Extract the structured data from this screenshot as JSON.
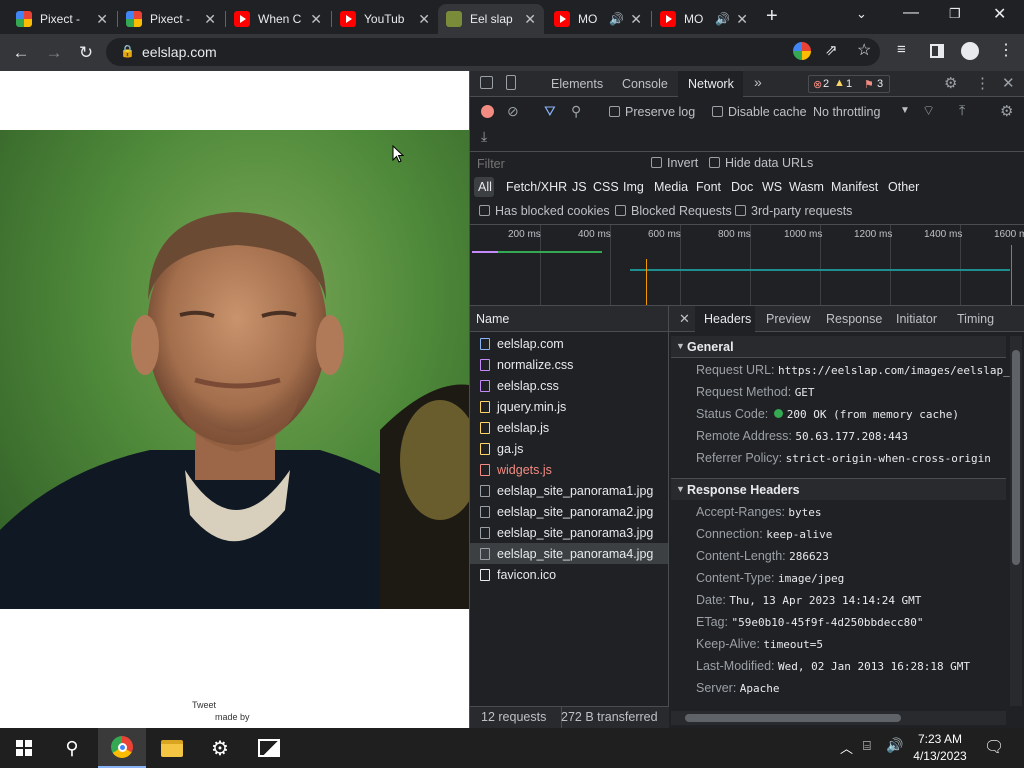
{
  "tabs": [
    {
      "title": "Pixect -",
      "icon": "pixect-icon"
    },
    {
      "title": "Pixect -",
      "icon": "pixect-icon"
    },
    {
      "title": "When C",
      "icon": "youtube-icon"
    },
    {
      "title": "YouTub",
      "icon": "youtube-icon"
    },
    {
      "title": "Eel slap",
      "icon": "eelslap-icon"
    },
    {
      "title": "MO",
      "icon": "youtube-icon"
    },
    {
      "title": "MO",
      "icon": "youtube-icon"
    }
  ],
  "new_tab": "+",
  "address": {
    "url": "eelslap.com"
  },
  "page": {
    "tweet": "Tweet",
    "made_by": "made by"
  },
  "devtools": {
    "tabs": [
      "Elements",
      "Console",
      "Network"
    ],
    "active_tab": "Network",
    "more": "»",
    "errors": "2",
    "warnings": "1",
    "issues": "3",
    "preserve_log": "Preserve log",
    "disable_cache": "Disable cache",
    "throttling": "No throttling",
    "filter_placeholder": "Filter",
    "invert": "Invert",
    "hide_data_urls": "Hide data URLs",
    "types": [
      "All",
      "Fetch/XHR",
      "JS",
      "CSS",
      "Img",
      "Media",
      "Font",
      "Doc",
      "WS",
      "Wasm",
      "Manifest",
      "Other"
    ],
    "blocked_cookies": "Has blocked cookies",
    "blocked_requests": "Blocked Requests",
    "third_party": "3rd-party requests",
    "timeline_ticks": [
      "200 ms",
      "400 ms",
      "600 ms",
      "800 ms",
      "1000 ms",
      "1200 ms",
      "1400 ms",
      "1600 m"
    ],
    "name_header": "Name",
    "requests": [
      {
        "name": "eelslap.com",
        "color": "#8ab4f8"
      },
      {
        "name": "normalize.css",
        "color": "#c58af9"
      },
      {
        "name": "eelslap.css",
        "color": "#c58af9"
      },
      {
        "name": "jquery.min.js",
        "color": "#fdd663"
      },
      {
        "name": "eelslap.js",
        "color": "#fdd663"
      },
      {
        "name": "ga.js",
        "color": "#fdd663"
      },
      {
        "name": "widgets.js",
        "color": "#f28b82"
      },
      {
        "name": "eelslap_site_panorama1.jpg",
        "color": "#9aa0a6"
      },
      {
        "name": "eelslap_site_panorama2.jpg",
        "color": "#9aa0a6"
      },
      {
        "name": "eelslap_site_panorama3.jpg",
        "color": "#9aa0a6"
      },
      {
        "name": "eelslap_site_panorama4.jpg",
        "color": "#9aa0a6"
      },
      {
        "name": "favicon.ico",
        "color": "#e8eaed"
      }
    ],
    "detail_tabs": [
      "Headers",
      "Preview",
      "Response",
      "Initiator",
      "Timing"
    ],
    "general_title": "General",
    "general": [
      {
        "k": "Request URL:",
        "v": "https://eelslap.com/images/eelslap_"
      },
      {
        "k": "Request Method:",
        "v": "GET"
      },
      {
        "k": "Status Code:",
        "v": "200 OK (from memory cache)"
      },
      {
        "k": "Remote Address:",
        "v": "50.63.177.208:443"
      },
      {
        "k": "Referrer Policy:",
        "v": "strict-origin-when-cross-origin"
      }
    ],
    "response_title": "Response Headers",
    "response": [
      {
        "k": "Accept-Ranges:",
        "v": "bytes"
      },
      {
        "k": "Connection:",
        "v": "keep-alive"
      },
      {
        "k": "Content-Length:",
        "v": "286623"
      },
      {
        "k": "Content-Type:",
        "v": "image/jpeg"
      },
      {
        "k": "Date:",
        "v": "Thu, 13 Apr 2023 14:14:24 GMT"
      },
      {
        "k": "ETag:",
        "v": "\"59e0b10-45f9f-4d250bbdecc80\""
      },
      {
        "k": "Keep-Alive:",
        "v": "timeout=5"
      },
      {
        "k": "Last-Modified:",
        "v": "Wed, 02 Jan 2013 16:28:18 GMT"
      },
      {
        "k": "Server:",
        "v": "Apache"
      }
    ],
    "status_requests": "12 requests",
    "status_transferred": "272 B transferred"
  },
  "taskbar": {
    "time": "7:23 AM",
    "date": "4/13/2023"
  }
}
